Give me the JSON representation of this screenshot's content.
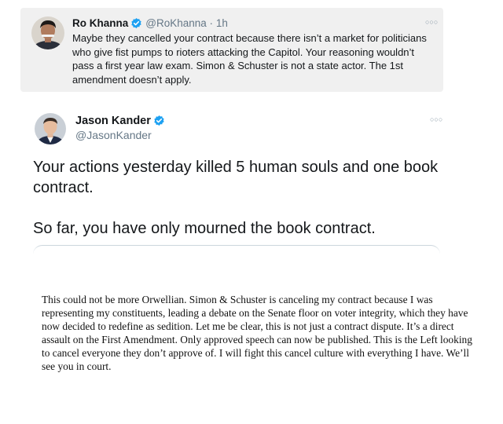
{
  "quoted_tweet": {
    "name": "Ro Khanna",
    "handle": "@RoKhanna",
    "separator": "·",
    "time": "1h",
    "text": "Maybe they cancelled your contract because there isn’t a market for politicians who give fist pumps to rioters attacking the Capitol. Your reasoning wouldn’t pass a first year law exam. Simon & Schuster is not a state actor. The 1st amendment doesn’t apply.",
    "more_icon": "more-horizontal-icon"
  },
  "main_tweet": {
    "name": "Jason Kander",
    "handle": "@JasonKander",
    "paragraphs": [
      "Your actions yesterday killed 5 human souls and one book contract.",
      "So far, you have only mourned the book contract."
    ],
    "more_icon": "more-horizontal-icon"
  },
  "statement": {
    "text": "This could not be more Orwellian. Simon & Schuster is canceling my contract because I was representing my constituents, leading a debate on the Senate floor on voter integrity, which they have now decided to redefine as sedition. Let me be clear, this is not just a contract dispute. It’s a direct assault on the First Amendment. Only approved speech can now be published. This is the Left looking to cancel everyone they don’t approve of. I will fight this cancel culture with everything I have. We’ll see you in court."
  },
  "colors": {
    "verified_badge": "#1da1f2",
    "handle": "#657786",
    "quoted_background": "#f0f0f0"
  }
}
